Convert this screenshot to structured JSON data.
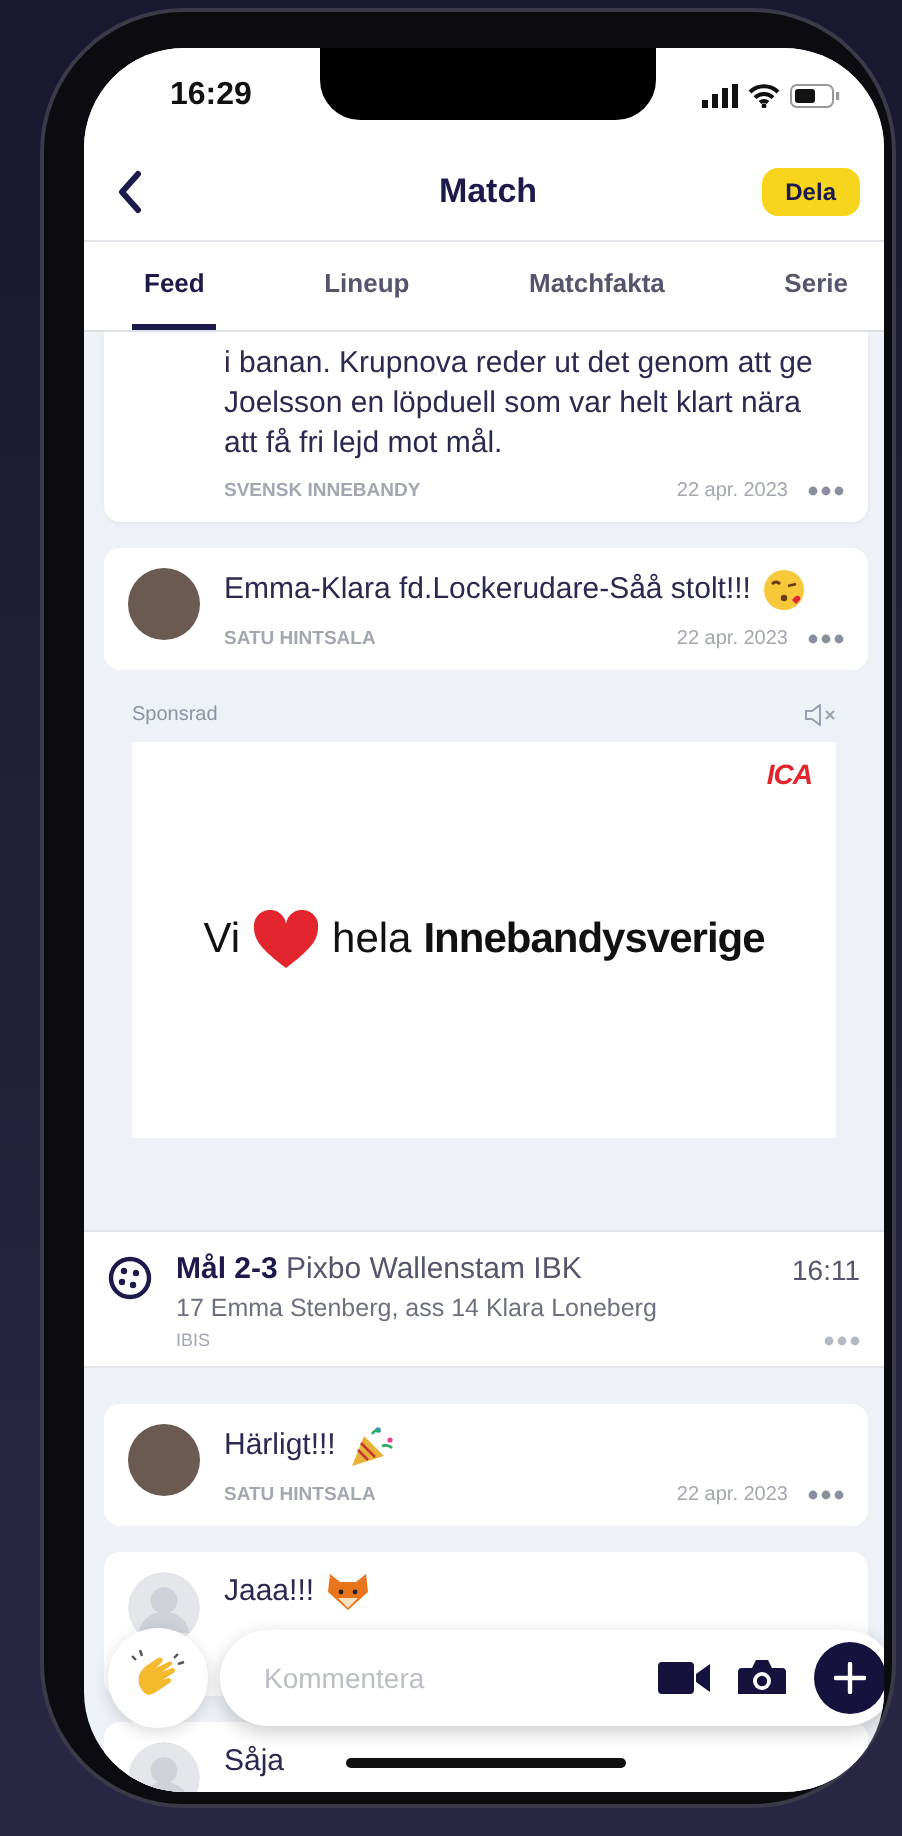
{
  "status_bar": {
    "time": "16:29"
  },
  "header": {
    "title": "Match",
    "share_button": "Dela"
  },
  "tabs": [
    {
      "label": "Feed",
      "selected": true
    },
    {
      "label": "Lineup",
      "selected": false
    },
    {
      "label": "Matchfakta",
      "selected": false
    },
    {
      "label": "Serie",
      "selected": false
    }
  ],
  "feed": [
    {
      "kind": "post",
      "text": "i banan. Krupnova reder ut det genom att ge Joelsson en löpduell som var helt klart nära att få fri lejd mot mål.",
      "author": "SVENSK INNEBANDY",
      "date": "22 apr. 2023"
    },
    {
      "kind": "comment",
      "has_photo": true,
      "text": "Emma-Klara fd.Lockerudare-Såå stolt!!!",
      "author": "SATU HINTSALA",
      "date": "22 apr. 2023"
    },
    {
      "kind": "ad",
      "label": "Sponsrad",
      "brand": "ICA",
      "tagline_start": "Vi",
      "tagline_middle": "hela",
      "tagline_end": "Innebandysverige"
    },
    {
      "kind": "event",
      "title": "**Mål 2-3** Pixbo Wallenstam IBK",
      "time": "16:11",
      "detail": "17 Emma Stenberg, ass 14 Klara Loneberg",
      "source": "IBIS"
    },
    {
      "kind": "comment",
      "has_photo": true,
      "text": "Härligt!!!",
      "author": "SATU HINTSALA",
      "date": "22 apr. 2023"
    },
    {
      "kind": "comment",
      "has_photo": false,
      "text": "Jaaa!!!"
    },
    {
      "kind": "comment",
      "has_photo": false,
      "text": "Såja"
    }
  ],
  "composer": {
    "placeholder": "Kommentera"
  }
}
